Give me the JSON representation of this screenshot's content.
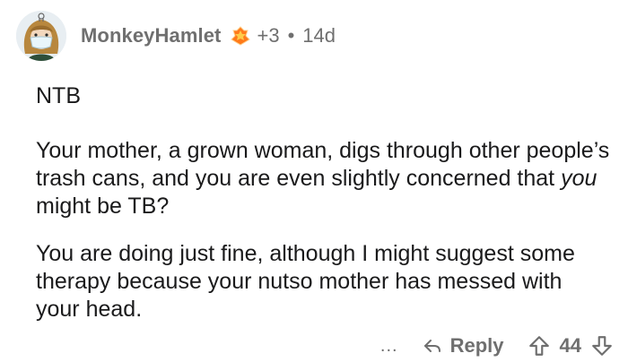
{
  "comment": {
    "username": "MonkeyHamlet",
    "award_count": "+3",
    "separator": "•",
    "age": "14d",
    "paragraphs": [
      {
        "text": "NTB"
      },
      {
        "text_before": "Your mother, a grown woman, digs through other people’s trash cans, and you are even slightly concerned that ",
        "italic": "you",
        "text_after": " might be TB?"
      },
      {
        "text": "You are doing just fine, although I might suggest some therapy because your nutso mother has messed with your head."
      }
    ]
  },
  "actions": {
    "more_label": "...",
    "reply_label": "Reply",
    "vote_count": "44"
  },
  "icons": {
    "award": "award-icon",
    "reply": "reply-arrow-icon",
    "upvote": "upvote-arrow-icon",
    "downvote": "downvote-arrow-icon",
    "avatar": "avatar-illustration"
  },
  "colors": {
    "text": "#1a1a1b",
    "meta": "#6f6f6f",
    "background": "#ffffff"
  }
}
